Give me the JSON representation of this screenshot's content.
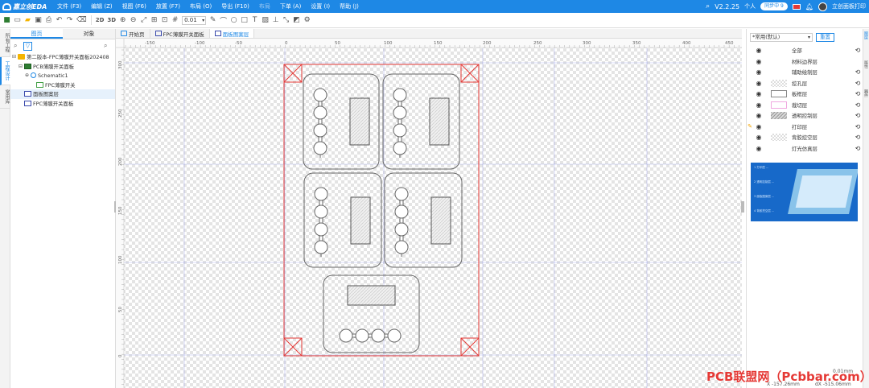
{
  "app": {
    "logo": "嘉立创EDA",
    "menu": [
      "文件 (F3)",
      "编辑 (Z)",
      "视图 (F6)",
      "放置 (F7)",
      "布局 (O)",
      "导出 (F10)",
      "布局",
      "下单 (A)",
      "设置 (I)",
      "帮助 (J)"
    ],
    "version": "V2.2.25",
    "user_mode": "个人",
    "sync_status": "同步中 9",
    "user_name": "立创面板打印"
  },
  "toolbar": {
    "view_2d": "2D",
    "view_3d": "3D",
    "grid_value": "0.01"
  },
  "left_tabs": [
    "所有工程",
    "工程设计",
    "常用库"
  ],
  "left_panel": {
    "tabs": [
      "图页",
      "对象"
    ],
    "tree": [
      {
        "label": "第二版本-FPC薄膜开关面板202408",
        "level": 0,
        "icon": "folder"
      },
      {
        "label": "PCB薄膜开关面板",
        "level": 1,
        "icon": "pcb"
      },
      {
        "label": "Schematic1",
        "level": 2,
        "icon": "schematic"
      },
      {
        "label": "FPC薄膜开关",
        "level": 3,
        "icon": "fpc"
      },
      {
        "label": "面板图案层",
        "level": 1,
        "icon": "panel",
        "selected": true
      },
      {
        "label": "FPC薄膜开关面板",
        "level": 1,
        "icon": "panel"
      }
    ]
  },
  "doc_tabs": [
    {
      "label": "开始页",
      "active": false
    },
    {
      "label": "FPC薄膜开关面板",
      "active": false
    },
    {
      "label": "面板图案层",
      "active": true
    }
  ],
  "ruler": {
    "x_labels": [
      "-150",
      "-100",
      "-50",
      "0",
      "50",
      "100",
      "150",
      "200",
      "250",
      "300",
      "350",
      "400",
      "450"
    ],
    "y_labels": [
      "300",
      "250",
      "200",
      "150",
      "100",
      "50",
      "0"
    ]
  },
  "right_panel": {
    "preset": "*常用(默认)",
    "apply_button": "重置",
    "layers": [
      {
        "name": "全部",
        "swatch": "none",
        "lock": true,
        "pen": false
      },
      {
        "name": "材料边界层",
        "swatch": "none",
        "lock": false,
        "pen": false
      },
      {
        "name": "辅助绘制层",
        "swatch": "none",
        "lock": true,
        "pen": false
      },
      {
        "name": "挖孔层",
        "swatch": "checker",
        "lock": true,
        "pen": false
      },
      {
        "name": "板框层",
        "swatch": "white",
        "lock": true,
        "pen": false
      },
      {
        "name": "裁切层",
        "swatch": "pink",
        "lock": true,
        "pen": false
      },
      {
        "name": "透明控制层",
        "swatch": "hatch",
        "lock": true,
        "pen": false
      },
      {
        "name": "打印层",
        "swatch": "none",
        "lock": true,
        "pen": true
      },
      {
        "name": "背胶挖空层",
        "swatch": "checker",
        "lock": true,
        "pen": false
      },
      {
        "name": "灯光仿真层",
        "swatch": "none",
        "lock": true,
        "pen": false
      }
    ],
    "preview_lines": [
      "1 打印层 ...",
      "2 透明控制层 ...",
      "3 面板图案层 ...",
      "4 背胶挖空层 ..."
    ]
  },
  "far_right_tabs": [
    "图层",
    "属性",
    "器件"
  ],
  "status": {
    "grid_readout": "0.01mm",
    "x_readout": "X -157.26mm",
    "dx_readout": "dX -515.06mm"
  },
  "watermark": "PCB联盟网（Pcbbar.com）",
  "colors": {
    "accent": "#1e88e5",
    "board_outline": "#e53935",
    "grid_major": "#7e87e6"
  }
}
